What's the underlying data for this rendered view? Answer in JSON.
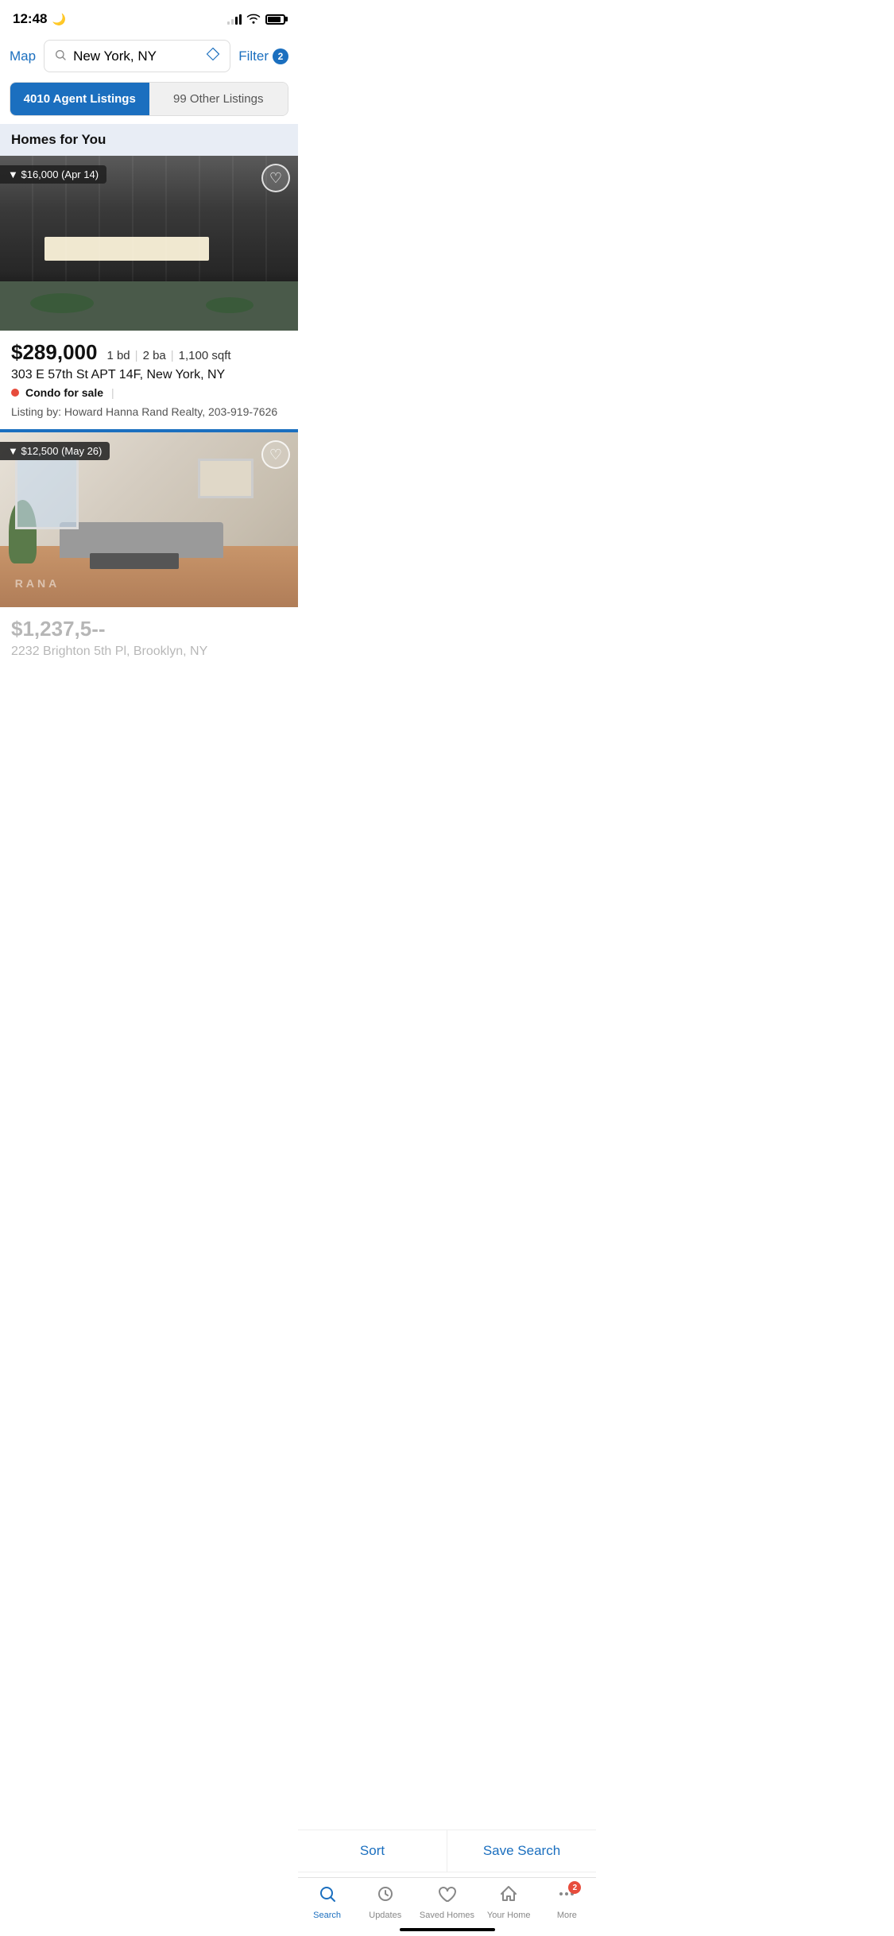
{
  "statusBar": {
    "time": "12:48",
    "moonIcon": "🌙"
  },
  "header": {
    "mapLabel": "Map",
    "searchValue": "New York, NY",
    "filterLabel": "Filter",
    "filterCount": "2"
  },
  "tabs": {
    "active": "4010 Agent Listings",
    "inactive": "99 Other Listings"
  },
  "sectionHeader": "Homes for You",
  "listings": [
    {
      "priceDrop": "▼ $16,000 (Apr 14)",
      "price": "$289,000",
      "beds": "1 bd",
      "baths": "2 ba",
      "sqft": "1,100 sqft",
      "address": "303 E 57th St APT 14F, New York, NY",
      "type": "Condo for sale",
      "listingBy": "Listing by: Howard Hanna Rand Realty, 203-919-7626"
    },
    {
      "priceDrop": "▼ $12,500 (May 26)",
      "price": "$1,237,500",
      "address": "2232 Brighton 5th Pl, Brooklyn, NY"
    }
  ],
  "sortSaveBar": {
    "sortLabel": "Sort",
    "saveSearchLabel": "Save Search"
  },
  "bottomNav": {
    "items": [
      {
        "label": "Search",
        "active": true
      },
      {
        "label": "Updates",
        "active": false
      },
      {
        "label": "Saved Homes",
        "active": false
      },
      {
        "label": "Your Home",
        "active": false
      },
      {
        "label": "More",
        "active": false,
        "badge": "2"
      }
    ]
  }
}
